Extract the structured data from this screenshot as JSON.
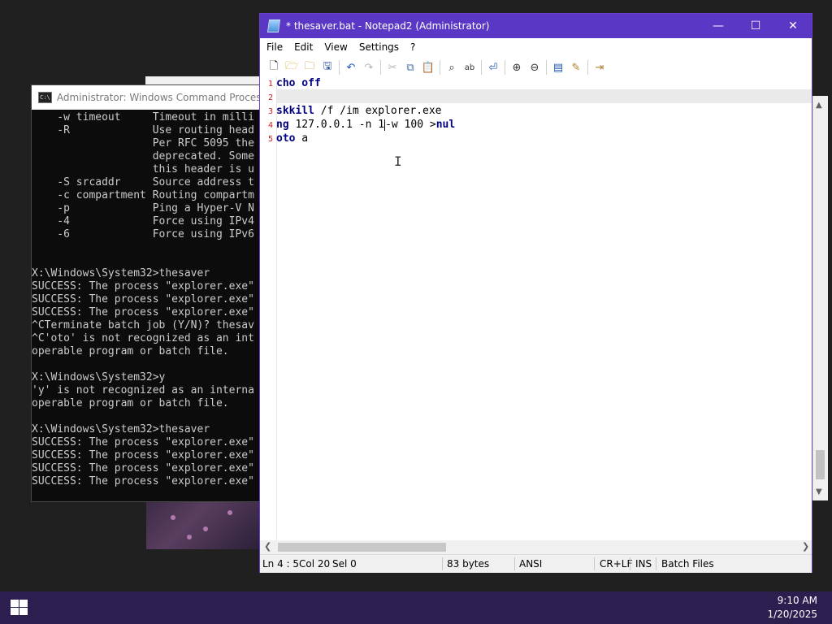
{
  "cmd": {
    "title": "Administrator: Windows Command Processor - ",
    "lines": [
      "    -w timeout     Timeout in milli",
      "    -R             Use routing head",
      "                   Per RFC 5095 the",
      "                   deprecated. Some",
      "                   this header is u",
      "    -S srcaddr     Source address t",
      "    -c compartment Routing compartm",
      "    -p             Ping a Hyper-V N",
      "    -4             Force using IPv4",
      "    -6             Force using IPv6",
      "",
      "",
      "X:\\Windows\\System32>thesaver",
      "SUCCESS: The process \"explorer.exe\"",
      "SUCCESS: The process \"explorer.exe\"",
      "SUCCESS: The process \"explorer.exe\"",
      "^CTerminate batch job (Y/N)? thesav",
      "^C'oto' is not recognized as an int",
      "operable program or batch file.",
      "",
      "X:\\Windows\\System32>y",
      "'y' is not recognized as an interna",
      "operable program or batch file.",
      "",
      "X:\\Windows\\System32>thesaver",
      "SUCCESS: The process \"explorer.exe\"",
      "SUCCESS: The process \"explorer.exe\"",
      "SUCCESS: The process \"explorer.exe\"",
      "SUCCESS: The process \"explorer.exe\""
    ]
  },
  "notepad": {
    "title": "* thesaver.bat - Notepad2 (Administrator)",
    "window_buttons": {
      "minimize": "—",
      "maximize": "☐",
      "close": "✕"
    },
    "menu": [
      "File",
      "Edit",
      "View",
      "Settings",
      "?"
    ],
    "toolbar_icons": [
      "new-file-icon",
      "open-file-icon",
      "browse-icon",
      "save-icon",
      "undo-icon",
      "redo-icon",
      "cut-icon",
      "copy-icon",
      "paste-icon",
      "find-icon",
      "replace-icon",
      "word-wrap-icon",
      "zoom-in-icon",
      "zoom-out-icon",
      "scheme-icon",
      "customize-icon",
      "exit-icon"
    ],
    "gutter": [
      "1",
      "2",
      "3",
      "4",
      "5"
    ],
    "code": [
      {
        "kw": "echo",
        "rest": " off"
      },
      {
        "kw": "",
        "rest": ""
      },
      {
        "kw": "askkill",
        "rest": " /f /im explorer.exe"
      },
      {
        "kw": "ing",
        "rest": " 127.0.0.1 -n 1",
        "after_caret": "-w 100 >",
        "kw2": "nul"
      },
      {
        "kw": "oto",
        "rest": " a"
      }
    ],
    "visible_code": [
      "cho off",
      "",
      "skkill /f /im explorer.exe",
      "ng 127.0.0.1 -n 1-w 100 >nul",
      "oto a"
    ],
    "status": {
      "position": "Ln 4 : 5",
      "col": "Col 20",
      "sel": "Sel 0",
      "size": "83 bytes",
      "encoding": "ANSI",
      "eol": "CR+LF",
      "mode": "INS",
      "scheme": "Batch Files"
    }
  },
  "taskbar": {
    "time": "9:10 AM",
    "date": "1/20/2025"
  },
  "colors": {
    "titlebar": "#5b37c6",
    "taskbar": "#2c1f4f",
    "keyword": "#000080",
    "line_numbers": "#d02020"
  }
}
